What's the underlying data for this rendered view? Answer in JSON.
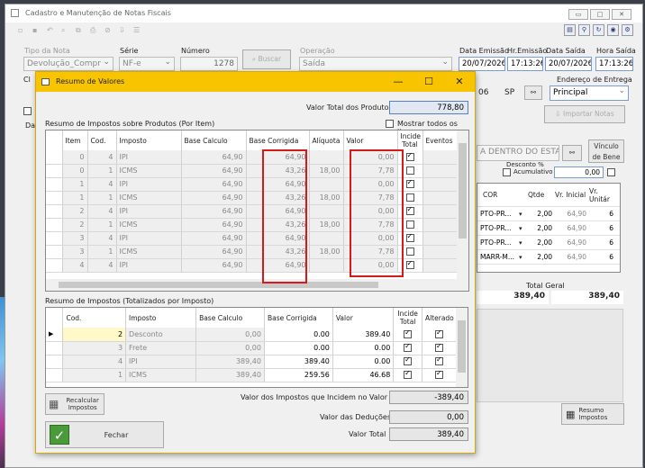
{
  "main": {
    "title": "Cadastro e Manutenção de Notas Fiscais",
    "win_controls": [
      "▭",
      "□",
      "✕"
    ],
    "labels": {
      "tipo_nota": "Tipo da Nota",
      "serie": "Série",
      "numero": "Número",
      "operacao": "Operação",
      "data_emissao": "Data Emissão",
      "hr_emissao": "Hr.Emissão",
      "data_saida": "Data Saída",
      "hora_saida": "Hora Saída",
      "endereco_entrega": "Endereço de Entrega",
      "ci": "Cl",
      "da": "Da"
    },
    "values": {
      "tipo_nota": "Devolução_Compr",
      "serie": "NF-e",
      "numero": "1278",
      "operacao": "Saída",
      "data_emissao": "20/07/2026",
      "hr_emissao": "17:13:26",
      "data_saida": "20/07/2026",
      "hora_saida": "17:13:26",
      "uf_num": "06",
      "uf": "SP",
      "endereco_entrega": "Principal"
    },
    "buttons": {
      "buscar": "Buscar",
      "importar_notas": "Importar Notas",
      "vinculo_bene": "Vínculo de Bene",
      "resumo_impostos": "Resumo Impostos"
    },
    "right_panel": {
      "dentro_estado": "A DENTRO DO ESTA",
      "desconto_label": "Desconto %",
      "acumulativo": "Acumulativo",
      "desconto_valor": "0,00",
      "headers": [
        "COR",
        "Qtde",
        "Vr. Inicial",
        "Vr. Unitár"
      ],
      "rows": [
        [
          "PTO-PR...",
          "2,00",
          "64,90",
          "6"
        ],
        [
          "PTO-PR...",
          "2,00",
          "64,90",
          "6"
        ],
        [
          "PTO-PR...",
          "2,00",
          "64,90",
          "6"
        ],
        [
          "MARR-M...",
          "2,00",
          "64,90",
          "6"
        ]
      ],
      "total_geral_label": "Total Geral",
      "total_left": "389,40",
      "total_right": "389,40"
    }
  },
  "modal": {
    "title": "Resumo de Valores",
    "controls": [
      "—",
      "☐",
      "✕"
    ],
    "valor_total_produtos_label": "Valor Total dos Produtos",
    "valor_total_produtos": "778,80",
    "section1_title": "Resumo de Impostos sobre Produtos (Por Item)",
    "mostrar_todos": "Mostrar todos os itens",
    "grid1_headers": [
      "Item",
      "Cod.",
      "Imposto",
      "Base Calculo",
      "Base Corrigida",
      "Alíquota",
      "Valor",
      "Incide Total",
      "Eventos"
    ],
    "grid1_rows": [
      {
        "item": "0",
        "cod": "4",
        "imposto": "IPI",
        "base": "64,90",
        "corr": "64,90",
        "aliq": "",
        "valor": "0,00",
        "incide": true
      },
      {
        "item": "0",
        "cod": "1",
        "imposto": "ICMS",
        "base": "64,90",
        "corr": "43,26",
        "aliq": "18,00",
        "valor": "7,78",
        "incide": false
      },
      {
        "item": "1",
        "cod": "4",
        "imposto": "IPI",
        "base": "64,90",
        "corr": "64,90",
        "aliq": "",
        "valor": "0,00",
        "incide": true
      },
      {
        "item": "1",
        "cod": "1",
        "imposto": "ICMS",
        "base": "64,90",
        "corr": "43,26",
        "aliq": "18,00",
        "valor": "7,78",
        "incide": false
      },
      {
        "item": "2",
        "cod": "4",
        "imposto": "IPI",
        "base": "64,90",
        "corr": "64,90",
        "aliq": "",
        "valor": "0,00",
        "incide": true
      },
      {
        "item": "2",
        "cod": "1",
        "imposto": "ICMS",
        "base": "64,90",
        "corr": "43,26",
        "aliq": "18,00",
        "valor": "7,78",
        "incide": false
      },
      {
        "item": "3",
        "cod": "4",
        "imposto": "IPI",
        "base": "64,90",
        "corr": "64,90",
        "aliq": "",
        "valor": "0,00",
        "incide": true
      },
      {
        "item": "3",
        "cod": "1",
        "imposto": "ICMS",
        "base": "64,90",
        "corr": "43,26",
        "aliq": "18,00",
        "valor": "7,78",
        "incide": false
      },
      {
        "item": "4",
        "cod": "4",
        "imposto": "IPI",
        "base": "64,90",
        "corr": "64,90",
        "aliq": "",
        "valor": "0,00",
        "incide": true
      }
    ],
    "section2_title": "Resumo de Impostos (Totalizados por Imposto)",
    "grid2_headers": [
      "Cod.",
      "Imposto",
      "Base Calculo",
      "Base Corrigida",
      "Valor",
      "Incide Total",
      "Alterado"
    ],
    "grid2_rows": [
      {
        "cod": "2",
        "imposto": "Desconto",
        "base": "0,00",
        "corr": "0.00",
        "valor": "389.40",
        "incide": true,
        "alterado": true,
        "current": true
      },
      {
        "cod": "3",
        "imposto": "Frete",
        "base": "0,00",
        "corr": "0.00",
        "valor": "0.00",
        "incide": true,
        "alterado": true
      },
      {
        "cod": "4",
        "imposto": "IPI",
        "base": "389,40",
        "corr": "389.40",
        "valor": "0.00",
        "incide": true,
        "alterado": true
      },
      {
        "cod": "1",
        "imposto": "ICMS",
        "base": "389,40",
        "corr": "259.56",
        "valor": "46.68",
        "incide": true,
        "alterado": true
      }
    ],
    "recalcular": "Recalcular Impostos",
    "fechar": "Fechar",
    "valor_impostos_label": "Valor dos Impostos que Incidem no Valor Total",
    "valor_impostos": "-389,40",
    "valor_deducoes_label": "Valor das Deduções",
    "valor_deducoes": "0,00",
    "valor_total_label": "Valor Total",
    "valor_total": "389,40"
  }
}
